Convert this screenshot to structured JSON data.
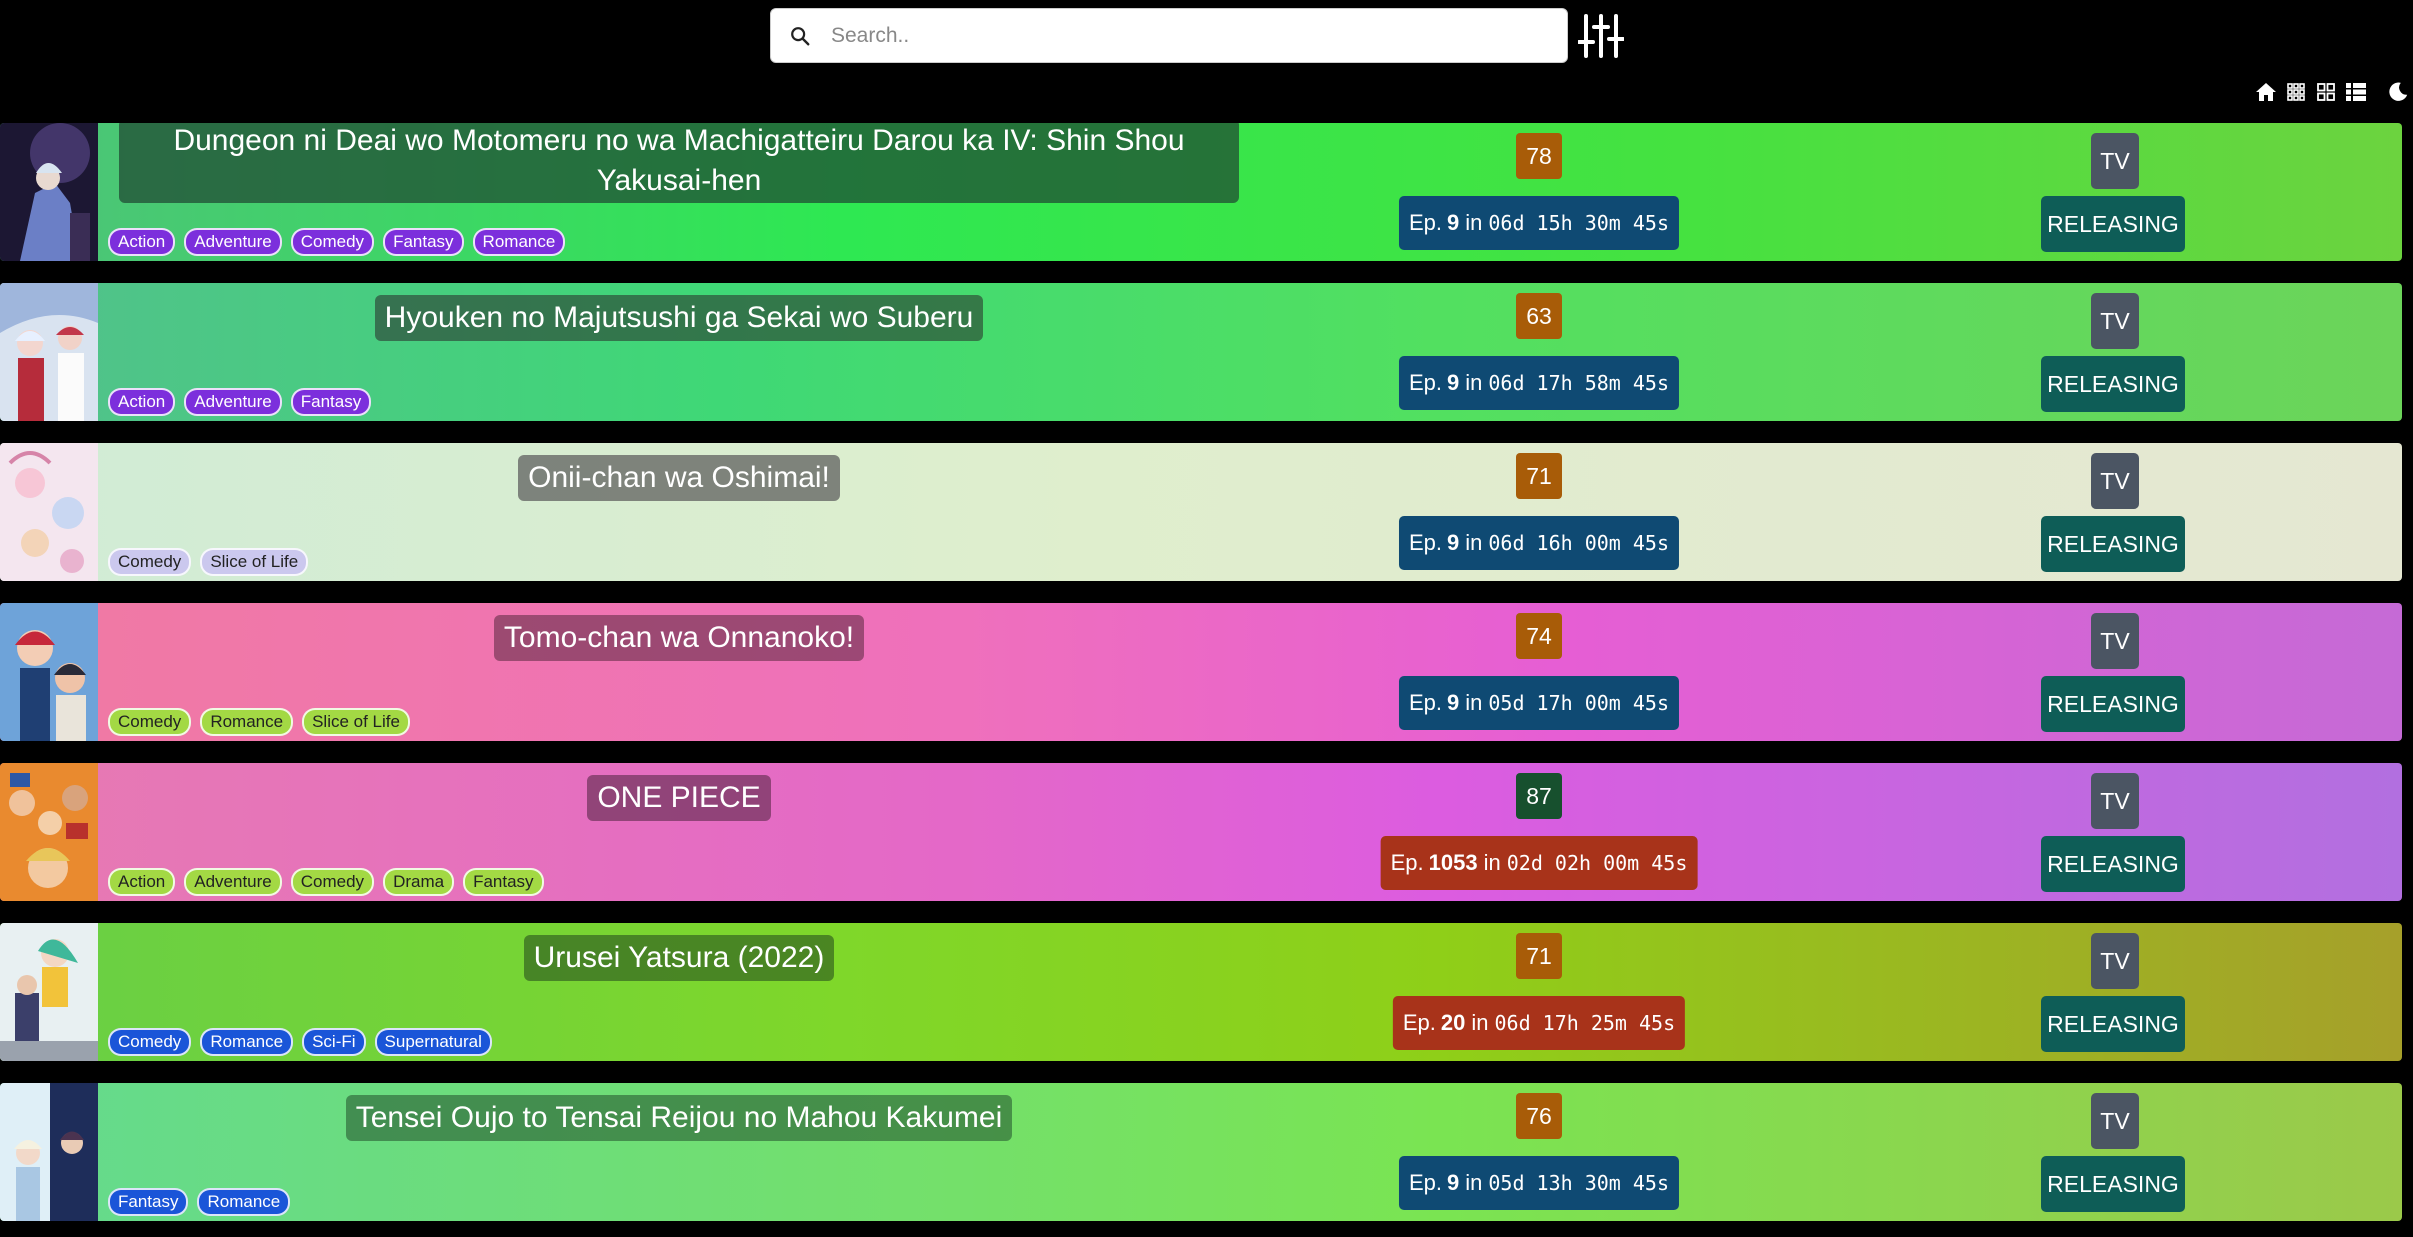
{
  "search": {
    "placeholder": "Search.."
  },
  "icons": {
    "search": "search-icon",
    "filter": "sliders-icon",
    "home": "home-icon",
    "grid_small": "grid-small-icon",
    "grid_large": "grid-large-icon",
    "list": "list-icon",
    "theme": "moon-icon"
  },
  "colors": {
    "score_orange": "#a85c08",
    "score_green": "#17502e",
    "ep_blue": "#0f4a73",
    "ep_red": "#a8331a",
    "format_bg": "#4b5563",
    "status_bg": "#0e5d57"
  },
  "episode_prefix": "Ep.",
  "episode_in": "in",
  "anime": [
    {
      "title": "Dungeon ni Deai wo Motomeru no wa Machigatteiru Darou ka IV: Shin Shou Yakusai-hen",
      "genres": [
        "Action",
        "Adventure",
        "Comedy",
        "Fantasy",
        "Romance"
      ],
      "score": "78",
      "episode": "9",
      "countdown": "06d 15h 30m 45s",
      "format": "TV",
      "status": "RELEASING"
    },
    {
      "title": "Hyouken no Majutsushi ga Sekai wo Suberu",
      "genres": [
        "Action",
        "Adventure",
        "Fantasy"
      ],
      "score": "63",
      "episode": "9",
      "countdown": "06d 17h 58m 45s",
      "format": "TV",
      "status": "RELEASING"
    },
    {
      "title": "Onii-chan wa Oshimai!",
      "genres": [
        "Comedy",
        "Slice of Life"
      ],
      "score": "71",
      "episode": "9",
      "countdown": "06d 16h 00m 45s",
      "format": "TV",
      "status": "RELEASING"
    },
    {
      "title": "Tomo-chan wa Onnanoko!",
      "genres": [
        "Comedy",
        "Romance",
        "Slice of Life"
      ],
      "score": "74",
      "episode": "9",
      "countdown": "05d 17h 00m 45s",
      "format": "TV",
      "status": "RELEASING"
    },
    {
      "title": "ONE PIECE",
      "genres": [
        "Action",
        "Adventure",
        "Comedy",
        "Drama",
        "Fantasy"
      ],
      "score": "87",
      "episode": "1053",
      "countdown": "02d 02h 00m 45s",
      "format": "TV",
      "status": "RELEASING"
    },
    {
      "title": "Urusei Yatsura (2022)",
      "genres": [
        "Comedy",
        "Romance",
        "Sci-Fi",
        "Supernatural"
      ],
      "score": "71",
      "episode": "20",
      "countdown": "06d 17h 25m 45s",
      "format": "TV",
      "status": "RELEASING"
    },
    {
      "title": "Tensei Oujo to Tensai Reijou no Mahou Kakumei",
      "genres": [
        "Fantasy",
        "Romance"
      ],
      "score": "76",
      "episode": "9",
      "countdown": "05d 13h 30m 45s",
      "format": "TV",
      "status": "RELEASING"
    }
  ]
}
